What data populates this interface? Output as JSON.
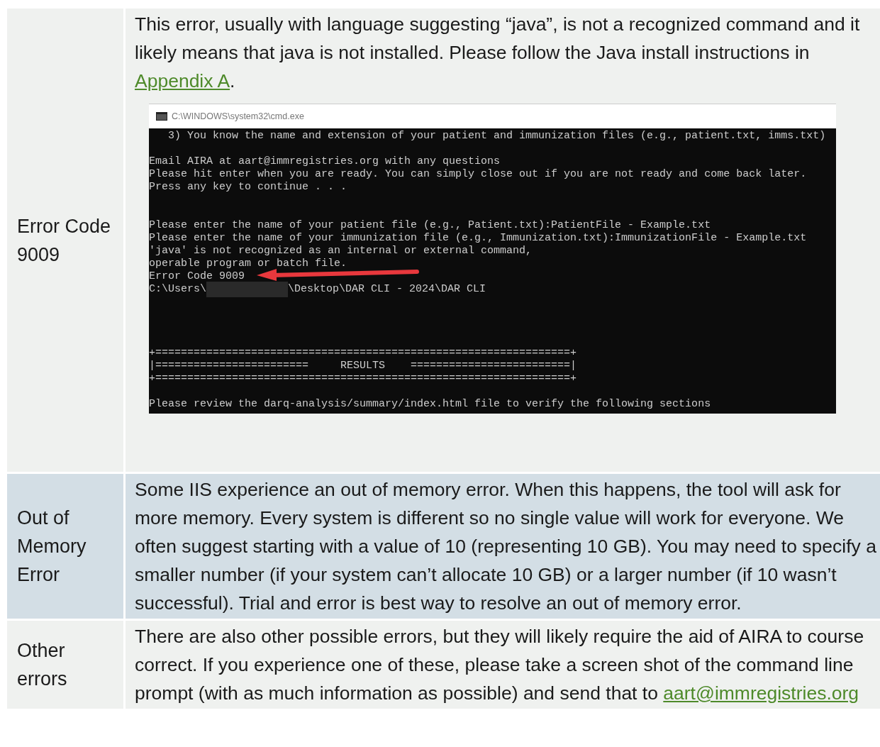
{
  "rows": [
    {
      "label": "Error Code 9009",
      "highlighted": false,
      "description": [
        {
          "kind": "text",
          "text": "This error, usually with language suggesting “java”, is not a recognized command and it likely means that java is not installed. Please follow the Java install instructions in "
        },
        {
          "kind": "link",
          "text": "Appendix A"
        },
        {
          "kind": "text",
          "text": "."
        }
      ],
      "terminal": {
        "title": "C:\\WINDOWS\\system32\\cmd.exe",
        "lines": [
          {
            "kind": "text",
            "text": "   3) You know the name and extension of your patient and immunization files (e.g., patient.txt, imms.txt)"
          },
          {
            "kind": "blank"
          },
          {
            "kind": "text",
            "text": "Email AIRA at aart@immregistries.org with any questions"
          },
          {
            "kind": "text",
            "text": "Please hit enter when you are ready. You can simply close out if you are not ready and come back later."
          },
          {
            "kind": "text",
            "text": "Press any key to continue . . ."
          },
          {
            "kind": "blank"
          },
          {
            "kind": "blank"
          },
          {
            "kind": "text",
            "text": "Please enter the name of your patient file (e.g., Patient.txt):PatientFile - Example.txt"
          },
          {
            "kind": "text",
            "text": "Please enter the name of your immunization file (e.g., Immunization.txt):ImmunizationFile - Example.txt"
          },
          {
            "kind": "text",
            "text": "'java' is not recognized as an internal or external command,"
          },
          {
            "kind": "text",
            "text": "operable program or batch file."
          },
          {
            "kind": "text",
            "text": "Error Code 9009"
          },
          {
            "kind": "redacted",
            "text": "C:\\Users\\",
            "after": "\\Desktop\\DAR CLI - 2024\\DAR CLI"
          },
          {
            "kind": "blank"
          },
          {
            "kind": "blank"
          },
          {
            "kind": "blank"
          },
          {
            "kind": "blank"
          },
          {
            "kind": "text",
            "text": "+=================================================================+"
          },
          {
            "kind": "text",
            "text": "|========================     RESULTS    =========================|"
          },
          {
            "kind": "text",
            "text": "+=================================================================+"
          },
          {
            "kind": "blank"
          },
          {
            "kind": "text",
            "text": "Please review the darq-analysis/summary/index.html file to verify the following sections"
          }
        ]
      }
    },
    {
      "label": "Out of Memory Error",
      "highlighted": true,
      "description": [
        {
          "kind": "text",
          "text": "Some IIS experience an out of memory error. When this happens, the tool will ask for more memory. Every system is different so no single value will work for everyone. We often suggest starting with a value of 10 (representing 10 GB). You may need to specify a smaller number (if your system can’t allocate 10 GB) or a larger number (if 10 wasn’t successful). Trial and error is best way to resolve an out of memory error."
        }
      ]
    },
    {
      "label": "Other errors",
      "highlighted": false,
      "description": [
        {
          "kind": "text",
          "text": "There are also other possible errors, but they will likely require the aid of AIRA to course correct. If you experience one of these, please take a screen shot of the command line prompt (with as much information as possible) and send that to "
        },
        {
          "kind": "link",
          "text": "aart@immregistries.org"
        }
      ]
    }
  ]
}
